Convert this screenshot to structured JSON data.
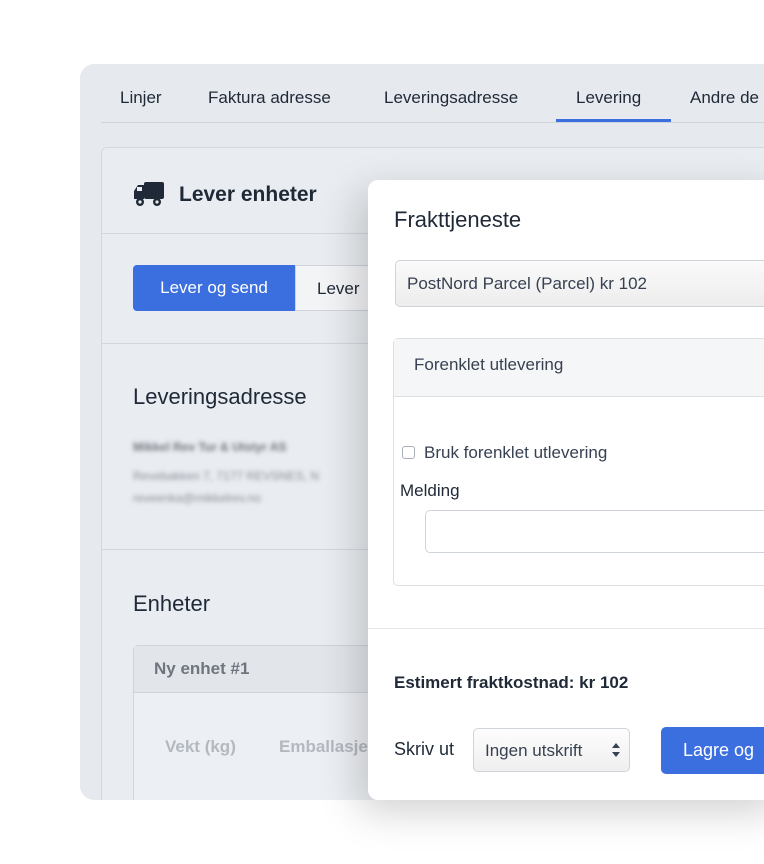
{
  "tabs": [
    {
      "label": "Linjer"
    },
    {
      "label": "Faktura adresse"
    },
    {
      "label": "Leveringsadresse"
    },
    {
      "label": "Levering",
      "active": true
    },
    {
      "label": "Andre de"
    }
  ],
  "card": {
    "title": "Lever enheter",
    "icon": "truck-icon",
    "buttons": {
      "primary": "Lever og send",
      "secondary": "Lever"
    }
  },
  "address": {
    "title": "Leveringsadresse",
    "name": "Mikkel Rev Tur & Utstyr AS",
    "street": "Revebakken 7, 7177 REVSNES, N",
    "email": "reveenka@mikkelrev.no"
  },
  "units": {
    "title": "Enheter",
    "unit_title": "Ny enhet #1",
    "columns": [
      "Vekt (kg)",
      "Emballasje"
    ]
  },
  "modal": {
    "title": "Frakttjeneste",
    "service_value": "PostNord Parcel (Parcel) kr 102",
    "panel_title": "Forenklet utlevering",
    "checkbox_label": "Bruk forenklet utlevering",
    "checkbox_checked": false,
    "message_label": "Melding",
    "message_value": "",
    "estimate": "Estimert fraktkostnad:  kr 102",
    "print_label": "Skriv ut",
    "print_value": "Ingen utskrift",
    "save_label": "Lagre og"
  },
  "colors": {
    "accent": "#3b6fe0",
    "background": "#e6e9ee"
  }
}
